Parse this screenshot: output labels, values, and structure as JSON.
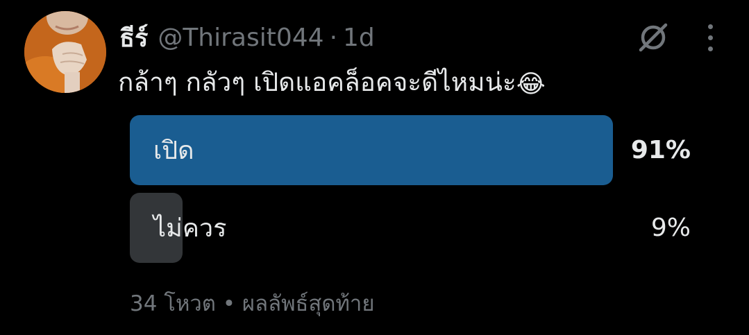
{
  "tweet": {
    "author": {
      "display_name": "ธีร์",
      "handle": "@Thirasit044",
      "separator": "·",
      "time": "1d"
    },
    "text": "กล้าๆ กลัวๆ เปิดแอคล็อคจะดีไหมน่ะ",
    "emoji": "😂",
    "icons": {
      "grok": "grok-icon",
      "more": "more-icon"
    }
  },
  "poll": {
    "options": [
      {
        "label": "เปิด",
        "percent_text": "91%",
        "percent": 91,
        "winner": true
      },
      {
        "label": "ไม่ควร",
        "percent_text": "9%",
        "percent": 9,
        "winner": false
      }
    ],
    "footer": "34 โหวต • ผลลัพธ์สุดท้าย",
    "colors": {
      "winner_bar": "#1a5d91",
      "other_bar": "#333639"
    }
  }
}
